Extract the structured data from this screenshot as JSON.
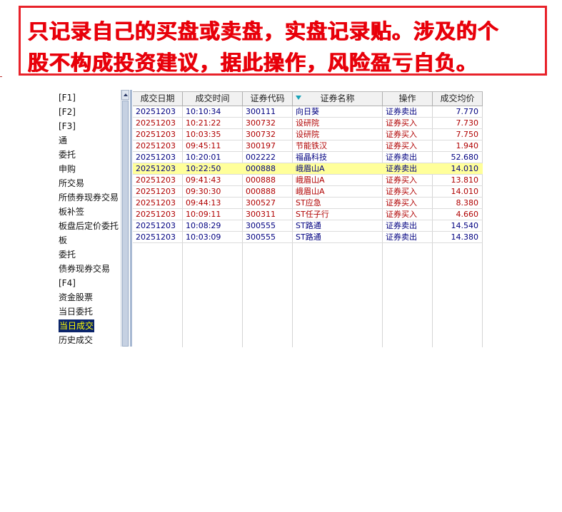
{
  "banner": {
    "line1": "只记录自己的买盘或卖盘，实盘记录贴。涉及的个",
    "line2": "股不构成投资建议，据此操作，风险盈亏自负。"
  },
  "sidebar": {
    "items": [
      "[F1]",
      "[F2]",
      "[F3]",
      "通",
      "委托",
      "申购",
      "所交易",
      "所债券现券交易",
      "板补签",
      "板盘后定价委托",
      "板",
      "委托",
      "债券现券交易",
      "[F4]",
      "资金股票",
      "当日委托",
      "当日成交",
      "历史成交"
    ],
    "selected_index": 16
  },
  "table": {
    "columns": [
      "成交日期",
      "成交时间",
      "证券代码",
      "证券名称",
      "操作",
      "成交均价"
    ],
    "rows": [
      {
        "date": "20251203",
        "time": "10:10:34",
        "code": "300111",
        "name": "向日葵",
        "op": "证券卖出",
        "price": "7.770",
        "side": "sell"
      },
      {
        "date": "20251203",
        "time": "10:21:22",
        "code": "300732",
        "name": "设研院",
        "op": "证券买入",
        "price": "7.730",
        "side": "buy"
      },
      {
        "date": "20251203",
        "time": "10:03:35",
        "code": "300732",
        "name": "设研院",
        "op": "证券买入",
        "price": "7.750",
        "side": "buy"
      },
      {
        "date": "20251203",
        "time": "09:45:11",
        "code": "300197",
        "name": "节能铁汉",
        "op": "证券买入",
        "price": "1.940",
        "side": "buy"
      },
      {
        "date": "20251203",
        "time": "10:20:01",
        "code": "002222",
        "name": "福晶科技",
        "op": "证券卖出",
        "price": "52.680",
        "side": "sell"
      },
      {
        "date": "20251203",
        "time": "10:22:50",
        "code": "000888",
        "name": "峨眉山A",
        "op": "证券卖出",
        "price": "14.010",
        "side": "sell",
        "highlight": true
      },
      {
        "date": "20251203",
        "time": "09:41:43",
        "code": "000888",
        "name": "峨眉山A",
        "op": "证券买入",
        "price": "13.810",
        "side": "buy"
      },
      {
        "date": "20251203",
        "time": "09:30:30",
        "code": "000888",
        "name": "峨眉山A",
        "op": "证券买入",
        "price": "14.010",
        "side": "buy"
      },
      {
        "date": "20251203",
        "time": "09:44:13",
        "code": "300527",
        "name": "ST应急",
        "op": "证券买入",
        "price": "8.380",
        "side": "buy"
      },
      {
        "date": "20251203",
        "time": "10:09:11",
        "code": "300311",
        "name": "ST任子行",
        "op": "证券买入",
        "price": "4.660",
        "side": "buy"
      },
      {
        "date": "20251203",
        "time": "10:08:29",
        "code": "300555",
        "name": "ST路通",
        "op": "证券卖出",
        "price": "14.540",
        "side": "sell"
      },
      {
        "date": "20251203",
        "time": "10:03:09",
        "code": "300555",
        "name": "ST路通",
        "op": "证券卖出",
        "price": "14.380",
        "side": "sell"
      }
    ]
  },
  "colors": {
    "buy_text": "#b00000",
    "sell_text": "#000080",
    "highlight_row": "#ffff9a",
    "banner_red": "#e8000a",
    "selected_bg": "#0a246a",
    "selected_text": "#ffff00"
  }
}
